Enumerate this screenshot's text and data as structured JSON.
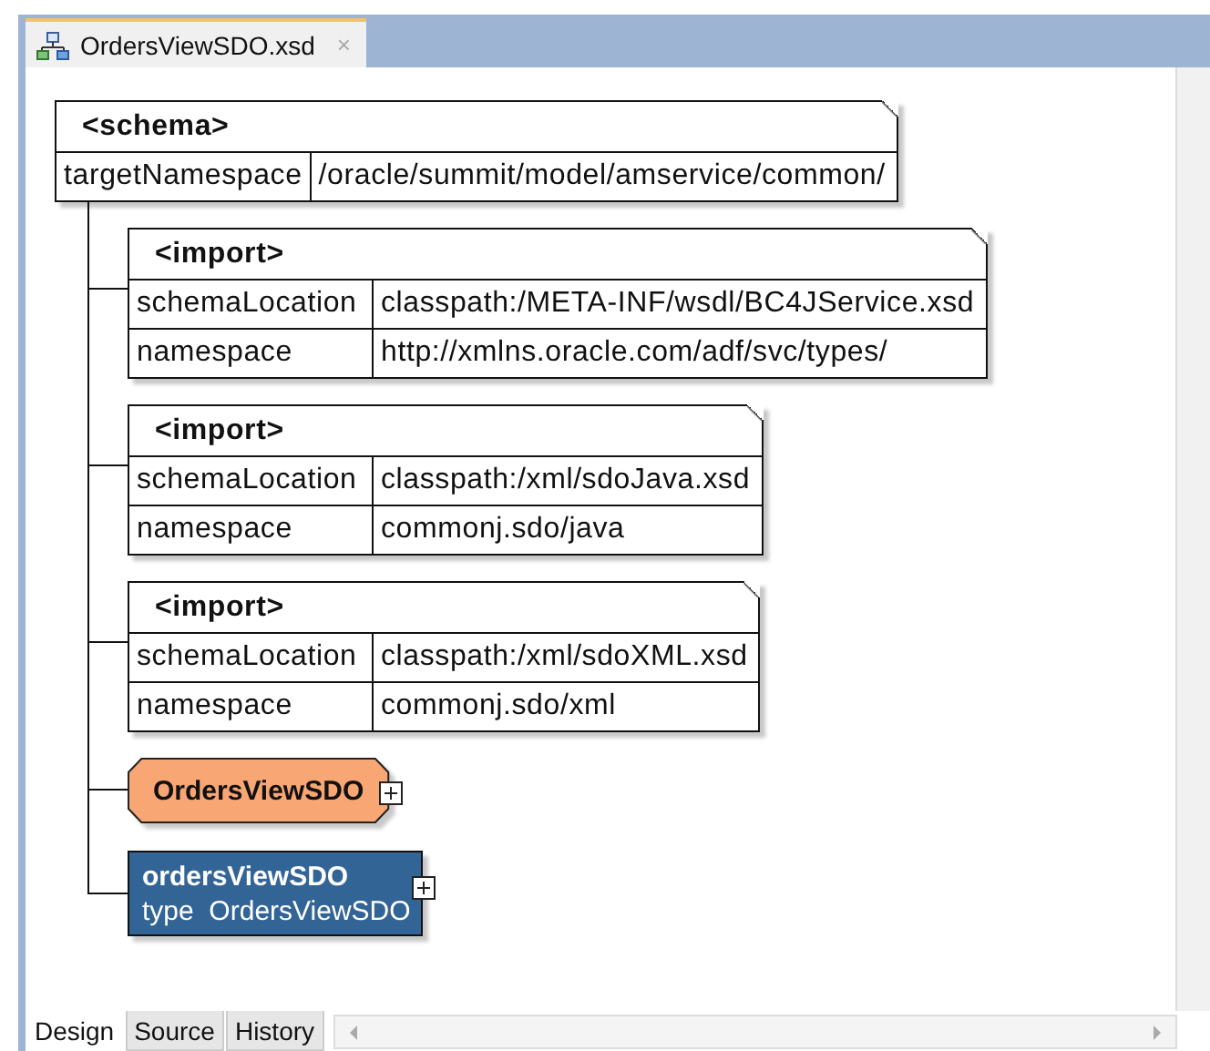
{
  "editor_tab": {
    "title": "OrdersViewSDO.xsd",
    "close": "×"
  },
  "schema": {
    "tag": "<schema>",
    "attributes": [
      {
        "name": "targetNamespace",
        "value": "/oracle/summit/model/amservice/common/"
      }
    ]
  },
  "children": [
    {
      "kind": "import",
      "tag": "<import>",
      "attributes": [
        {
          "name": "schemaLocation",
          "value": "classpath:/META-INF/wsdl/BC4JService.xsd"
        },
        {
          "name": "namespace",
          "value": "http://xmlns.oracle.com/adf/svc/types/"
        }
      ]
    },
    {
      "kind": "import",
      "tag": "<import>",
      "attributes": [
        {
          "name": "schemaLocation",
          "value": "classpath:/xml/sdoJava.xsd"
        },
        {
          "name": "namespace",
          "value": "commonj.sdo/java"
        }
      ]
    },
    {
      "kind": "import",
      "tag": "<import>",
      "attributes": [
        {
          "name": "schemaLocation",
          "value": "classpath:/xml/sdoXML.xsd"
        },
        {
          "name": "namespace",
          "value": "commonj.sdo/xml"
        }
      ]
    },
    {
      "kind": "complex_type",
      "name": "OrdersViewSDO"
    },
    {
      "kind": "element",
      "name": "ordersViewSDO",
      "type_label": "type",
      "type": "OrdersViewSDO"
    }
  ],
  "view_tabs": [
    {
      "label": "Design",
      "selected": true
    },
    {
      "label": "Source",
      "selected": false
    },
    {
      "label": "History",
      "selected": false
    }
  ]
}
